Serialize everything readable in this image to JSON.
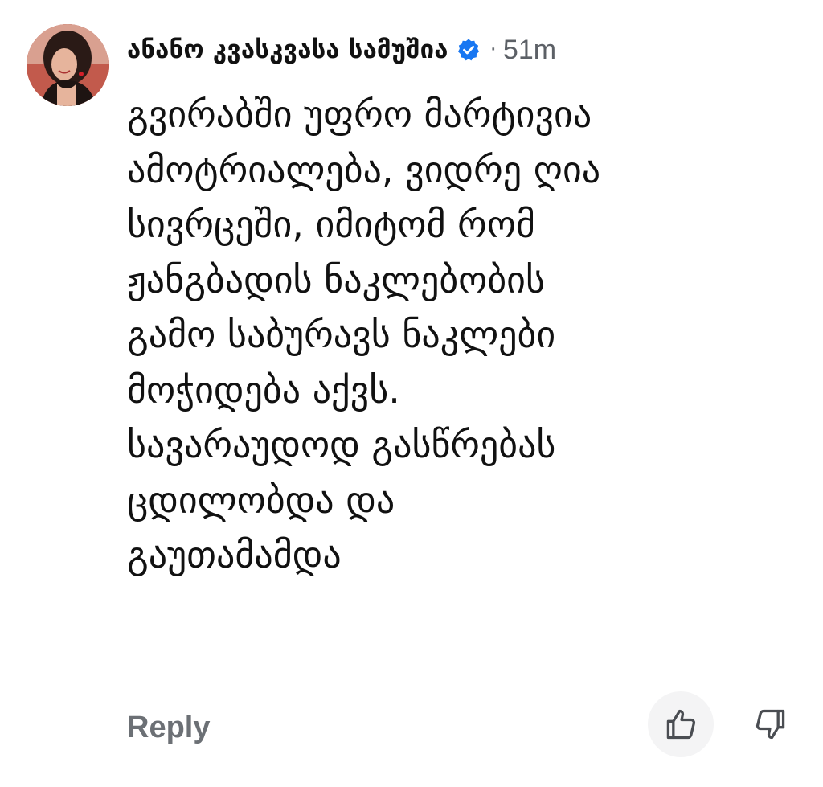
{
  "comment": {
    "author": "ანანო კვასკვასა სამუშია",
    "verified_icon": "verified-badge-icon",
    "separator": "·",
    "timestamp": "51m",
    "body_lines": [
      "გვირაბში უფრო მარტივია",
      "ამოტრიალება, ვიდრე ღია",
      "სივრცეში, იმიტომ რომ",
      "ჟანგბადის ნაკლებობის",
      "გამო საბურავს ნაკლები",
      "მოჭიდება აქვს.",
      "სავარაუდოდ გასწრებას",
      "ცდილობდა და",
      "გაუთამამდა"
    ]
  },
  "actions": {
    "reply_label": "Reply",
    "like_icon": "thumbs-up-icon",
    "dislike_icon": "thumbs-down-icon"
  },
  "colors": {
    "verified": "#1877f2",
    "muted_text": "#6c7075",
    "body_text": "#111111",
    "like_bg": "#f4f4f5"
  }
}
